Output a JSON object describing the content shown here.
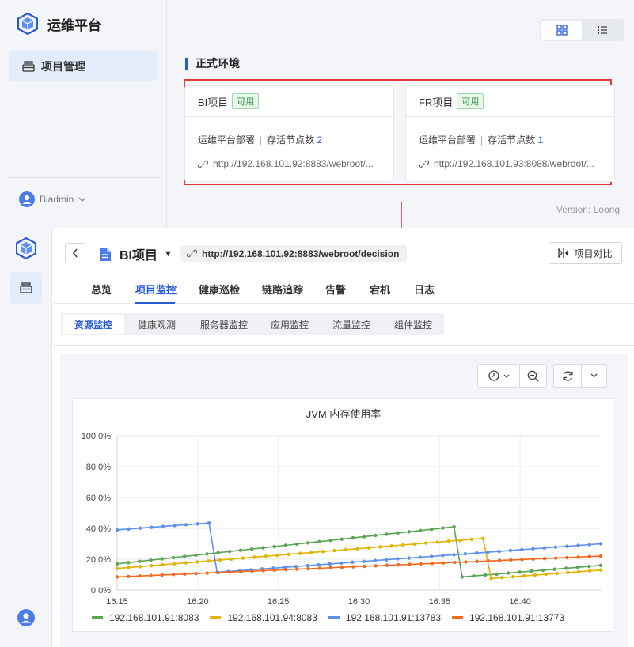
{
  "top": {
    "brand_name": "运维平台",
    "menu_item": "项目管理",
    "user": "Bladmin",
    "section_title": "正式环境",
    "cards": [
      {
        "name": "BI项目",
        "badge": "可用",
        "deploy": "运维平台部署",
        "nodes_label": "存活节点数",
        "nodes": "2",
        "url": "http://192.168.101.92:8883/webroot/..."
      },
      {
        "name": "FR项目",
        "badge": "可用",
        "deploy": "运维平台部署",
        "nodes_label": "存活节点数",
        "nodes": "1",
        "url": "http://192.168.101.93:8088/webroot/..."
      }
    ],
    "version": "Version: Loong"
  },
  "detail": {
    "project": "BI项目",
    "url": "http://192.168.101.92:8883/webroot/decision",
    "compare": "项目对比",
    "tabs": [
      "总览",
      "项目监控",
      "健康巡检",
      "链路追踪",
      "告警",
      "宕机",
      "日志"
    ],
    "active_tab": "项目监控",
    "subtabs": [
      "资源监控",
      "健康观测",
      "服务器监控",
      "应用监控",
      "流量监控",
      "组件监控"
    ],
    "active_subtab": "资源监控"
  },
  "colors": {
    "accent": "#2a5bd6",
    "danger": "#e0393e",
    "ok": "#2f9b45"
  },
  "chart_data": {
    "type": "line",
    "title": "JVM 内存使用率",
    "y_ticks": [
      "100.0%",
      "80.0%",
      "60.0%",
      "40.0%",
      "20.0%",
      "0.0%"
    ],
    "ylim": [
      0,
      100
    ],
    "x_ticks": [
      "16:15",
      "16:20",
      "16:25",
      "16:30",
      "16:35",
      "16:40"
    ],
    "x_minutes": [
      0,
      5,
      10,
      15,
      20,
      25
    ],
    "xlim": [
      0,
      30
    ],
    "series": [
      {
        "name": "192.168.101.91:8083",
        "color": "#5aa454",
        "x": [
          0,
          20.9,
          21.4,
          30
        ],
        "y": [
          17,
          41,
          8.5,
          16
        ]
      },
      {
        "name": "192.168.101.94:8083",
        "color": "#e0b400",
        "x": [
          0,
          22.7,
          23.2,
          30
        ],
        "y": [
          14,
          33.5,
          7.5,
          13
        ]
      },
      {
        "name": "192.168.101.91:13783",
        "color": "#5b8ff0",
        "x": [
          0,
          5.7,
          6.2,
          30
        ],
        "y": [
          39,
          43.5,
          11.5,
          30
        ]
      },
      {
        "name": "192.168.101.91:13773",
        "color": "#f06a1f",
        "x": [
          0,
          30
        ],
        "y": [
          8.5,
          22
        ]
      }
    ],
    "grid": true,
    "legend": "bottom"
  }
}
